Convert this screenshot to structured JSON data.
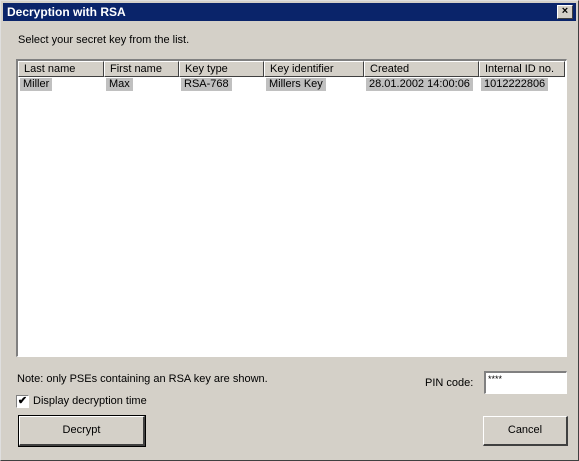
{
  "window": {
    "title": "Decryption with RSA",
    "close_label": "×"
  },
  "instruction": "Select your secret key from the list.",
  "table": {
    "columns": [
      "Last name",
      "First name",
      "Key type",
      "Key identifier",
      "Created",
      "Internal ID no."
    ],
    "rows": [
      [
        "Miller",
        "Max",
        "RSA-768",
        "Millers Key",
        "28.01.2002 14:00:06",
        "1012222806"
      ]
    ]
  },
  "note": "Note: only PSEs containing an RSA key are shown.",
  "pin": {
    "label": "PIN code:",
    "value": "****"
  },
  "display_time": {
    "label": "Display decryption time",
    "checked": true,
    "mark": "✔"
  },
  "buttons": {
    "decrypt_label": "Decrypt",
    "cancel_label": "Cancel"
  },
  "colors": {
    "title_bar": "#0a246a",
    "face": "#d4d0c8"
  }
}
